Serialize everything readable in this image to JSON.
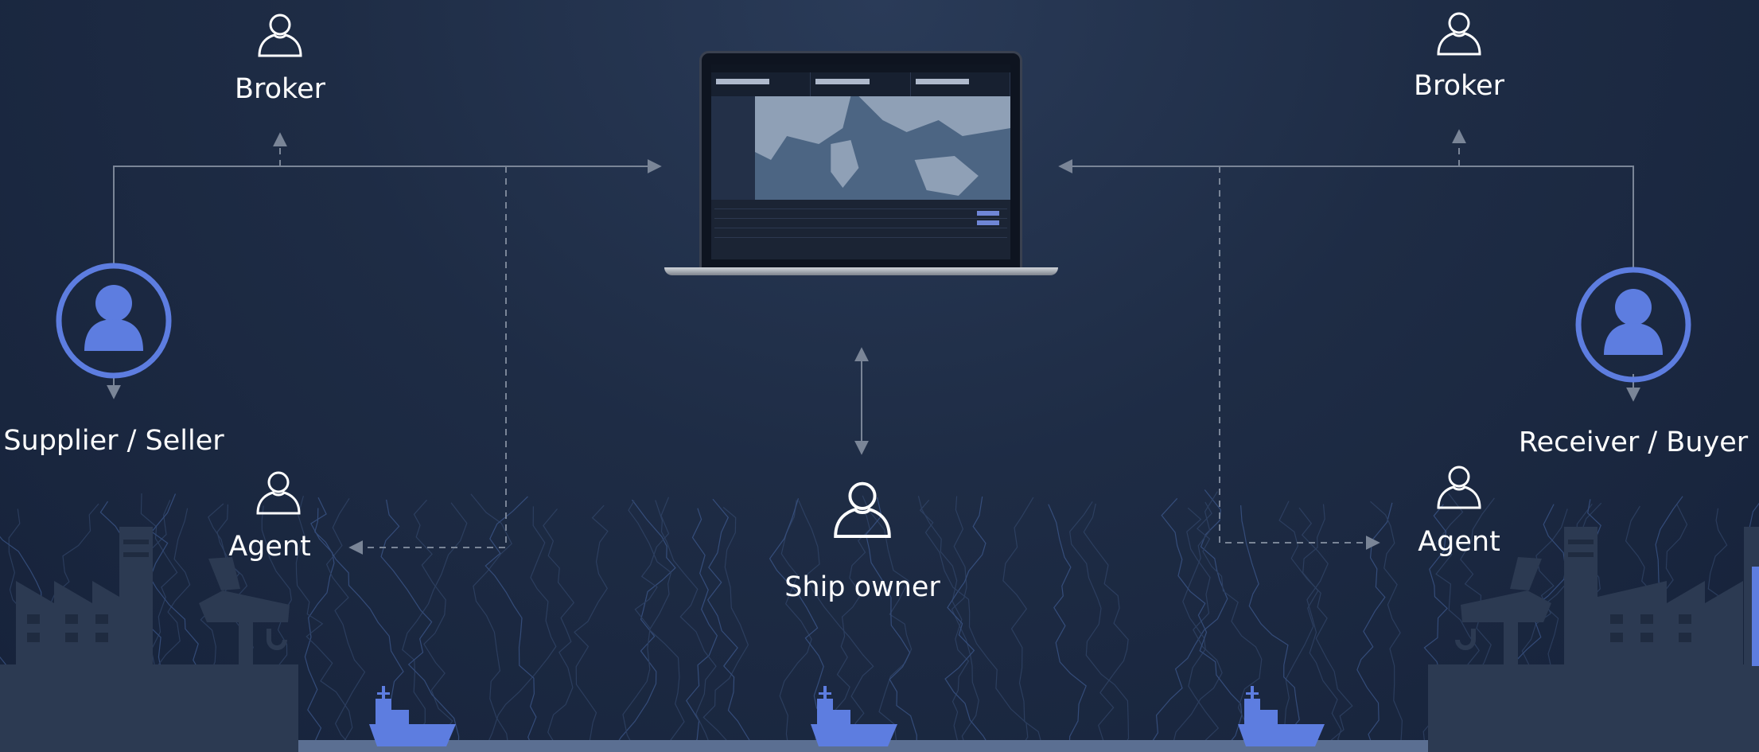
{
  "diagram": {
    "broker_left": "Broker",
    "broker_right": "Broker",
    "supplier": "Supplier / Seller",
    "receiver": "Receiver / Buyer",
    "agent_left": "Agent",
    "agent_right": "Agent",
    "ship_owner": "Ship owner"
  },
  "colors": {
    "accent": "#5d7de0",
    "line": "#7a8597",
    "silhouette": "#2c3a52",
    "label": "#ffffff"
  },
  "icons": {
    "small_person": "person-outline-icon",
    "big_person": "person-circle-icon",
    "factory": "factory-icon",
    "crane": "crane-icon",
    "ship": "ship-icon",
    "laptop": "laptop-icon"
  }
}
